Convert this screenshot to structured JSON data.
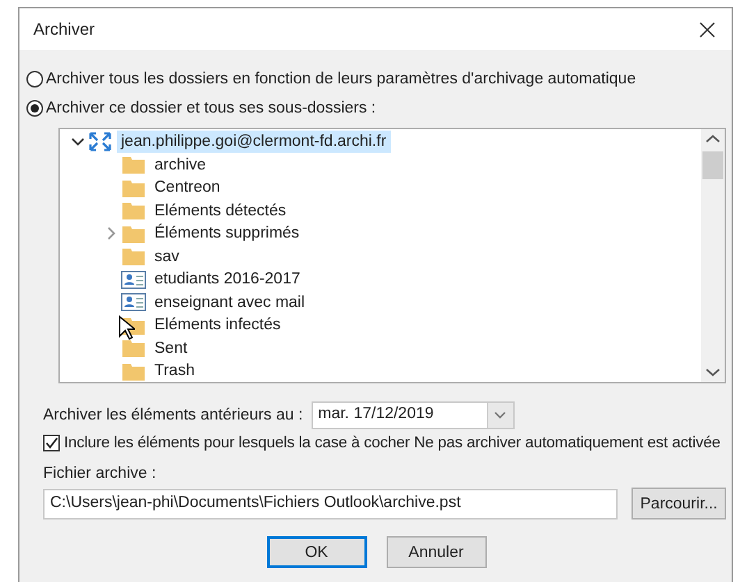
{
  "window": {
    "title": "Archiver"
  },
  "options": [
    {
      "label": "Archiver tous les dossiers en fonction de leurs paramètres d'archivage automatique",
      "selected": false
    },
    {
      "label": "Archiver ce dossier et tous ses sous-dossiers :",
      "selected": true
    }
  ],
  "folder_tree": {
    "root": {
      "label": "jean.philippe.goi@clermont-fd.archi.fr",
      "expanded": true,
      "selected": true,
      "children": [
        {
          "label": "archive",
          "kind": "folder",
          "expandable": false
        },
        {
          "label": "Centreon",
          "kind": "folder",
          "expandable": false
        },
        {
          "label": "Eléments détectés",
          "kind": "folder",
          "expandable": false
        },
        {
          "label": "Éléments supprimés",
          "kind": "folder",
          "expandable": true
        },
        {
          "label": "sav",
          "kind": "folder",
          "expandable": false
        },
        {
          "label": "etudiants 2016-2017",
          "kind": "contacts",
          "expandable": false
        },
        {
          "label": "enseignant avec mail",
          "kind": "contacts",
          "expandable": false
        },
        {
          "label": "Eléments infectés",
          "kind": "folder",
          "expandable": false
        },
        {
          "label": "Sent",
          "kind": "folder",
          "expandable": false
        },
        {
          "label": "Trash",
          "kind": "folder",
          "expandable": false
        }
      ]
    }
  },
  "older_than": {
    "label": "Archiver les éléments antérieurs au :",
    "value": "mar. 17/12/2019"
  },
  "include_option": {
    "label": "Inclure les éléments pour lesquels la case à cocher Ne pas archiver automatiquement est activée",
    "checked": true
  },
  "archive_file": {
    "label": "Fichier archive :",
    "value": "C:\\Users\\jean-phi\\Documents\\Fichiers Outlook\\archive.pst",
    "browse_button": "Parcourir..."
  },
  "buttons": [
    {
      "label": "OK",
      "default": true
    },
    {
      "label": "Annuler",
      "default": false
    }
  ]
}
